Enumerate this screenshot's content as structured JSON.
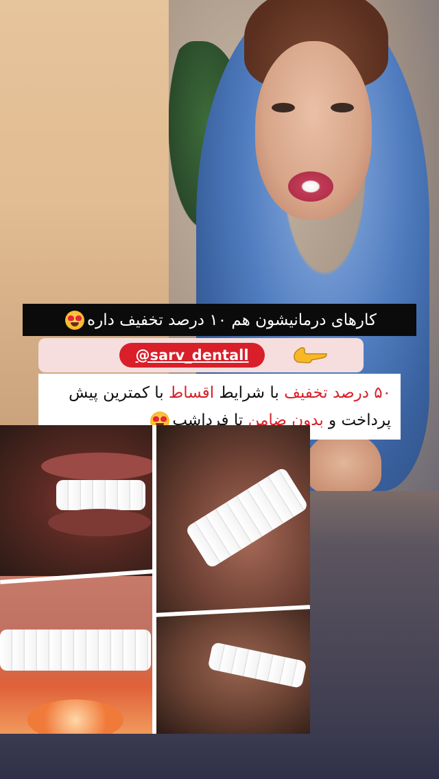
{
  "caption": {
    "text": "کارهای درمانیشون هم ۱۰ درصد تخفیف داره",
    "emoji_icon": "heart-eyes-emoji"
  },
  "handle": {
    "text": "@sarv_dentall",
    "pointer_icon": "pointing-hand-emoji"
  },
  "promo": {
    "part1_red": "۵۰ درصد تخفیف",
    "part2": " با شرایط ",
    "part3_red": "اقساط",
    "part4": " با کمترین پیش پرداخت و ",
    "part5_red": "بدون ضامن",
    "part6": " تا فرداشب",
    "emoji_icon": "heart-eyes-emoji"
  },
  "colors": {
    "accent_red": "#d8202a",
    "handle_bg": "#f5dedd",
    "caption_bg": "#0b0b0b"
  }
}
